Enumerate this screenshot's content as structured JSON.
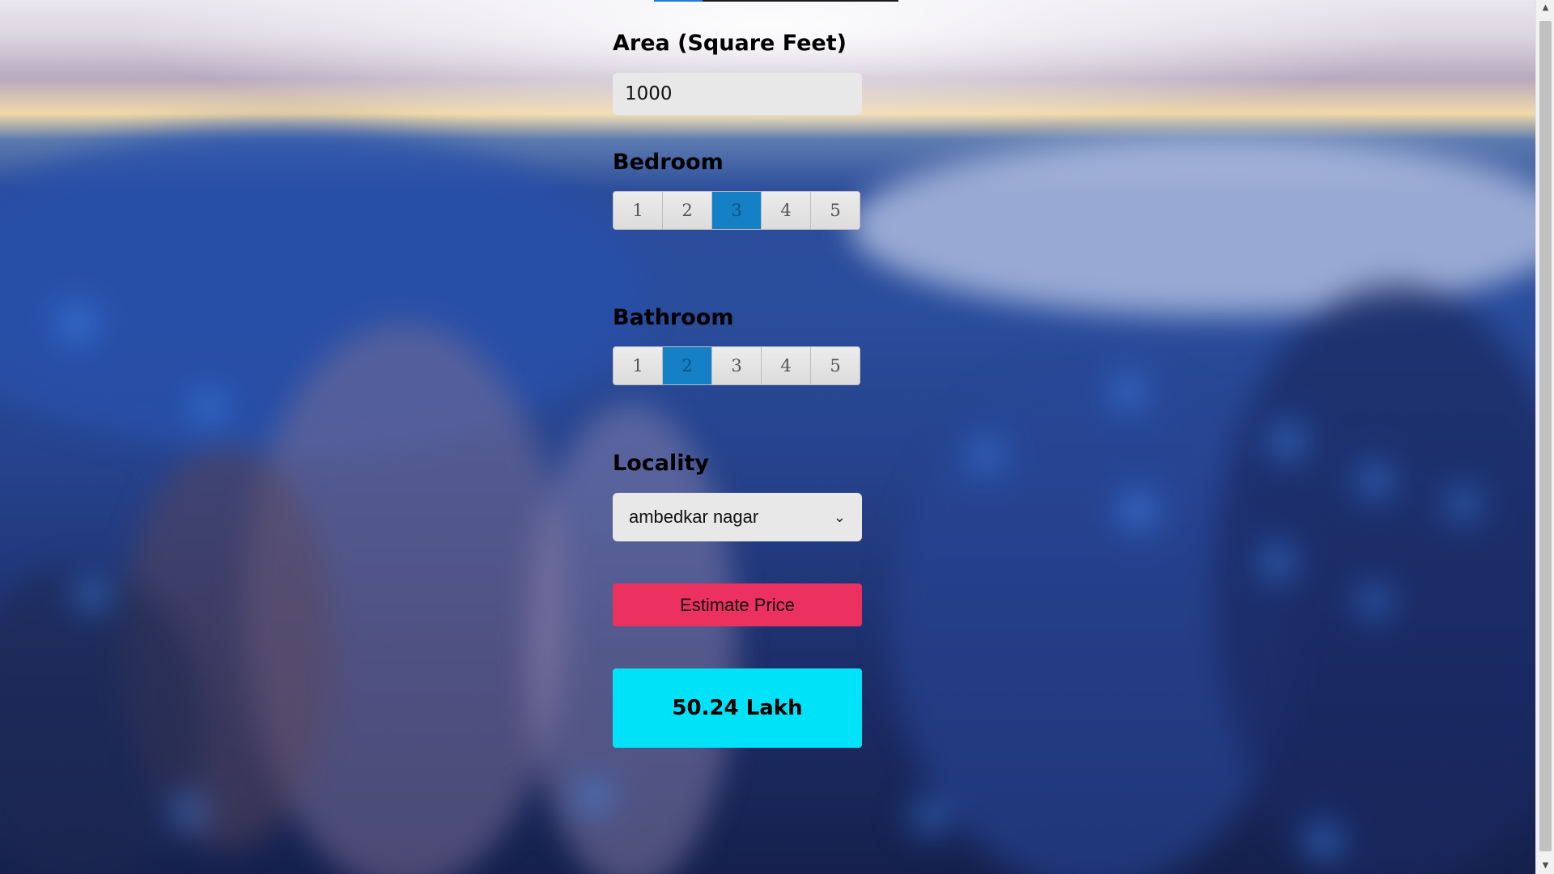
{
  "form": {
    "area": {
      "label": "Area (Square Feet)",
      "value": "1000"
    },
    "bedroom": {
      "label": "Bedroom",
      "options": [
        "1",
        "2",
        "3",
        "4",
        "5"
      ],
      "selected": "3"
    },
    "bathroom": {
      "label": "Bathroom",
      "options": [
        "1",
        "2",
        "3",
        "4",
        "5"
      ],
      "selected": "2"
    },
    "locality": {
      "label": "Locality",
      "selected": "ambedkar nagar"
    },
    "estimate_button": "Estimate Price",
    "result": "50.24 Lakh"
  },
  "colors": {
    "estimate_button": "#ec3160",
    "result_box": "#00e2f8",
    "segment_active": "#1580c6"
  }
}
